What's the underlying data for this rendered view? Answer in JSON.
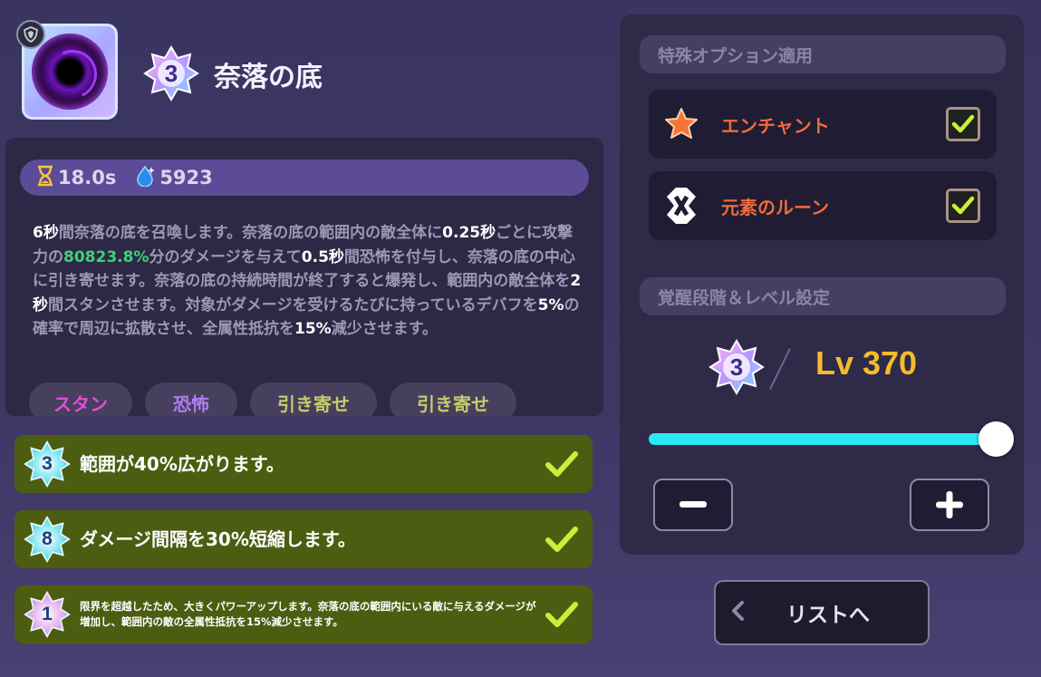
{
  "skill": {
    "title": "奈落の底",
    "awakening_level": "3",
    "cooldown": "18.0s",
    "mana": "5923",
    "description": [
      {
        "t": "6秒",
        "s": "b"
      },
      {
        "t": "間奈落の底を召喚します。奈落の底の範囲内の敵全体に",
        "s": ""
      },
      {
        "t": "0.25秒",
        "s": "b"
      },
      {
        "t": "ごとに攻撃力の",
        "s": ""
      },
      {
        "t": "80823.8%",
        "s": "green"
      },
      {
        "t": "分のダメージを与えて",
        "s": ""
      },
      {
        "t": "0.5秒",
        "s": "b"
      },
      {
        "t": "間恐怖を付与し、奈落の底の中心に引き寄せます。奈落の底の持続時間が終了すると爆発し、範囲内の敵全体を",
        "s": ""
      },
      {
        "t": "2秒",
        "s": "b"
      },
      {
        "t": "間スタンさせます。対象がダメージを受けるたびに持っているデバフを",
        "s": ""
      },
      {
        "t": "5%",
        "s": "b"
      },
      {
        "t": "の確率で周辺に拡散させ、全属性抵抗を",
        "s": ""
      },
      {
        "t": "15%",
        "s": "b"
      },
      {
        "t": "減少させます。",
        "s": ""
      }
    ],
    "tags": [
      {
        "label": "スタン",
        "color": "#e04fd8"
      },
      {
        "label": "恐怖",
        "color": "#b07cf0"
      },
      {
        "label": "引き寄せ",
        "color": "#c6cc6a"
      },
      {
        "label": "引き寄せ",
        "color": "#c6cc6a"
      }
    ]
  },
  "enhancements": [
    {
      "level": "3",
      "text": "範囲が40%広がります。",
      "star_color": "#41d6e8",
      "checked": true
    },
    {
      "level": "8",
      "text": "ダメージ間隔を30%短縮します。",
      "star_color": "#41d6e8",
      "checked": true
    },
    {
      "level": "1",
      "text": "限界を超越したため、大きくパワーアップします。奈落の底の範囲内にいる敵に与えるダメージが増加し、範囲内の敵の全属性抵抗を15%減少させます。",
      "star_color": "#d98ce8",
      "checked": true
    }
  ],
  "options": {
    "header": "特殊オプション適用",
    "items": [
      {
        "label": "エンチャント",
        "icon": "star-icon",
        "checked": true
      },
      {
        "label": "元素のルーン",
        "icon": "rune-icon",
        "checked": true
      }
    ]
  },
  "level_settings": {
    "header": "覚醒段階＆レベル設定",
    "awakening": "3",
    "level_text": "Lv 370",
    "slider_fraction": 1.0,
    "minus_label": "−",
    "plus_label": "+"
  },
  "list_button": {
    "label": "リストへ"
  },
  "colors": {
    "accent_cyan": "#2ae9f5",
    "level_gold": "#f5bb2a",
    "enh_green": "#4c5d12",
    "check_lime": "#c6f03a"
  }
}
